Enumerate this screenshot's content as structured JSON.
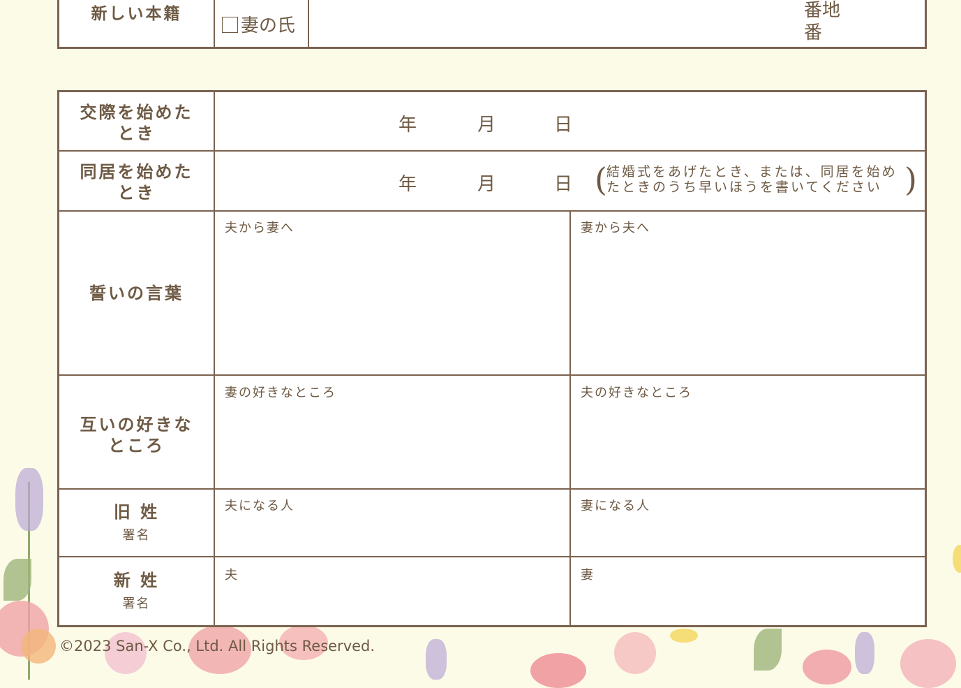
{
  "top_section": {
    "row_label": "新しい本籍",
    "checkbox_label": "妻の氏",
    "address_units": [
      "番地",
      "番"
    ]
  },
  "rows": {
    "dating_start": {
      "label_line1": "交際を始めた",
      "label_line2": "とき",
      "year": "年",
      "month": "月",
      "day": "日"
    },
    "living_start": {
      "label_line1": "同居を始めた",
      "label_line2": "とき",
      "year": "年",
      "month": "月",
      "day": "日",
      "note_line1": "結婚式をあげたとき、または、同居を始め",
      "note_line2": "たときのうち早いほうを書いてください"
    },
    "vows": {
      "label": "誓いの言葉",
      "left": "夫から妻へ",
      "right": "妻から夫へ"
    },
    "likes": {
      "label_line1": "互いの好きな",
      "label_line2": "ところ",
      "left": "妻の好きなところ",
      "right": "夫の好きなところ"
    },
    "old_surname": {
      "label": "旧 姓",
      "sub": "署名",
      "left": "夫になる人",
      "right": "妻になる人"
    },
    "new_surname": {
      "label": "新 姓",
      "sub": "署名",
      "left": "夫",
      "right": "妻"
    }
  },
  "copyright": "©2023 San-X Co., Ltd. All Rights Reserved.",
  "colors": {
    "border": "#7a6350",
    "text": "#6e5a44",
    "background": "#fcfbe8"
  }
}
